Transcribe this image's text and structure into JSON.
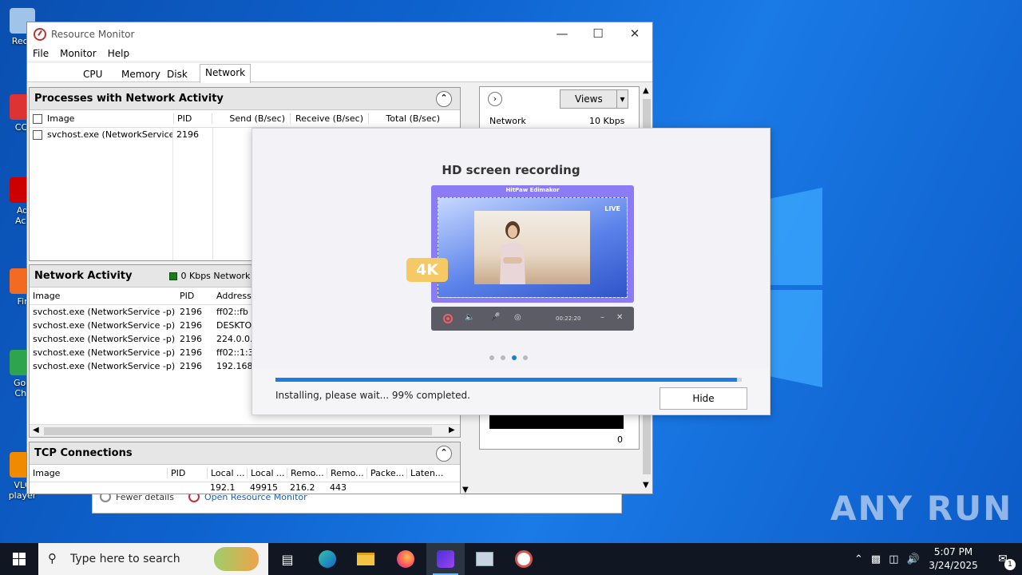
{
  "desktop": {
    "icons": [
      {
        "label": "Recy",
        "color": "#9fc4e8"
      },
      {
        "label": "CCl",
        "color": "#d33"
      },
      {
        "label": "Ad\nAcr",
        "color": "#c00"
      },
      {
        "label": "Fir",
        "color": "#f36b21"
      },
      {
        "label": "Goo\nChr",
        "color": "#2ea44f"
      },
      {
        "label": "VLC\nplayer",
        "color": "#f08a00"
      }
    ],
    "watermark": "ANY RUN"
  },
  "resource_monitor": {
    "title": "Resource Monitor",
    "menu": [
      "File",
      "Monitor",
      "Help"
    ],
    "tabs": [
      "CPU",
      "Memory",
      "Disk",
      "Network"
    ],
    "active_tab": "Network",
    "processes": {
      "title": "Processes with Network Activity",
      "columns": [
        "Image",
        "PID",
        "Send (B/sec)",
        "Receive (B/sec)",
        "Total (B/sec)"
      ],
      "rows": [
        {
          "image": "svchost.exe (NetworkService...",
          "pid": "2196"
        }
      ]
    },
    "network_activity": {
      "title": "Network Activity",
      "io": "0 Kbps Network I/O",
      "columns": [
        "Image",
        "PID",
        "Address"
      ],
      "rows": [
        {
          "image": "svchost.exe (NetworkService -p)",
          "pid": "2196",
          "address": "ff02::fb"
        },
        {
          "image": "svchost.exe (NetworkService -p)",
          "pid": "2196",
          "address": "DESKTOP"
        },
        {
          "image": "svchost.exe (NetworkService -p)",
          "pid": "2196",
          "address": "224.0.0.2"
        },
        {
          "image": "svchost.exe (NetworkService -p)",
          "pid": "2196",
          "address": "ff02::1:3"
        },
        {
          "image": "svchost.exe (NetworkService -p)",
          "pid": "2196",
          "address": "192.168."
        }
      ]
    },
    "tcp": {
      "title": "TCP Connections",
      "columns": [
        "Image",
        "PID",
        "Local ...",
        "Local ...",
        "Remo...",
        "Remo...",
        "Packe...",
        "Laten..."
      ],
      "partial_row": [
        "",
        "",
        "192.1",
        "49915",
        "216.2",
        "443",
        "",
        ""
      ]
    },
    "right_panel": {
      "views_label": "Views",
      "network_label": "Network",
      "network_value": "10 Kbps",
      "graph_min": "0"
    },
    "footer": {
      "fewer_details": "Fewer details",
      "open_rm": "Open Resource Monitor"
    }
  },
  "installer": {
    "heading": "HD screen recording",
    "preview_title": "HitPaw Edimakor",
    "live_label": "LIVE",
    "badge": "4K",
    "recording_time": "00:22:20",
    "slides": 4,
    "active_slide": 3,
    "progress": 0.99,
    "status": "Installing, please wait... 99% completed.",
    "hide_label": "Hide"
  },
  "taskbar": {
    "search_placeholder": "Type here to search",
    "time": "5:07 PM",
    "date": "3/24/2025",
    "notification_count": "1"
  }
}
